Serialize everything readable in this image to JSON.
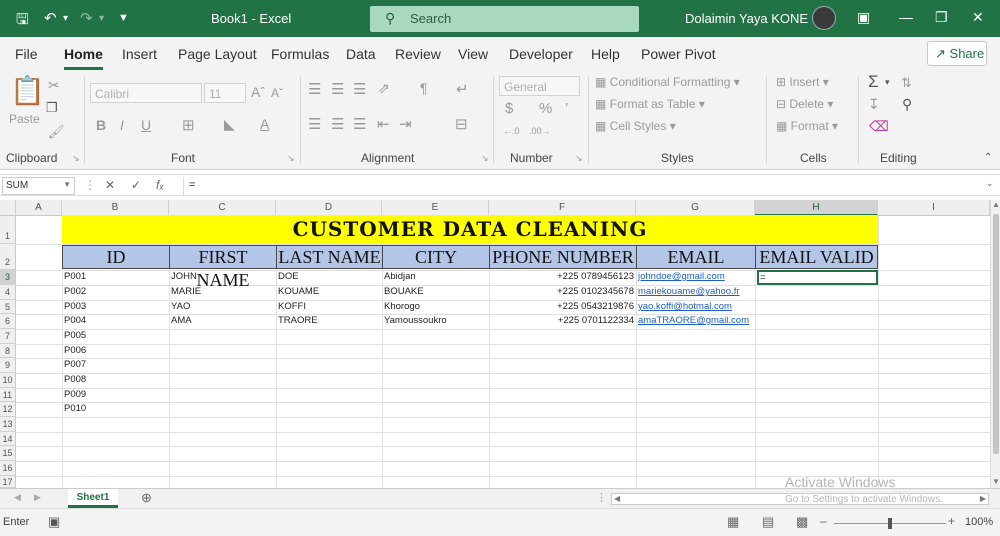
{
  "window": {
    "doc_title": "Book1 - Excel",
    "search_label": "Search",
    "user_name": "Dolaimin Yaya KONE"
  },
  "menu": [
    "File",
    "Home",
    "Insert",
    "Page Layout",
    "Formulas",
    "Data",
    "Review",
    "View",
    "Developer",
    "Help",
    "Power Pivot"
  ],
  "share_label": "Share",
  "ribbon": {
    "paste": "Paste",
    "font_name": "Calibri",
    "font_size": "11",
    "number_format": "General",
    "conditional_formatting": "Conditional Formatting",
    "format_as_table": "Format as Table",
    "cell_styles": "Cell Styles",
    "insert": "Insert",
    "delete": "Delete",
    "format": "Format",
    "groups": [
      "Clipboard",
      "Font",
      "Alignment",
      "Number",
      "Styles",
      "Cells",
      "Editing"
    ]
  },
  "formula_bar": {
    "name_box": "SUM",
    "content": "="
  },
  "columns": [
    "A",
    "B",
    "C",
    "D",
    "E",
    "F",
    "G",
    "H",
    "I"
  ],
  "rows": [
    "1",
    "2",
    "3",
    "4",
    "5",
    "6",
    "7",
    "8",
    "9",
    "10",
    "11",
    "12",
    "13",
    "14",
    "15",
    "16",
    "17"
  ],
  "sheet": {
    "title": "CUSTOMER DATA CLEANING",
    "headers": [
      "ID",
      "FIRST NAME",
      "LAST NAME",
      "CITY",
      "PHONE NUMBER",
      "EMAIL",
      "EMAIL VALID"
    ],
    "rows": [
      {
        "id": "P001",
        "first": "JOHN",
        "last": "DOE",
        "city": "Abidjan",
        "phone": "+225 0789456123",
        "email": "johndoe@gmail.com",
        "valid": "="
      },
      {
        "id": "P002",
        "first": "MARIE",
        "last": "KOUAME",
        "city": "BOUAKE",
        "phone": "+225 0102345678",
        "email": "mariekouame@yahoo.fr",
        "valid": ""
      },
      {
        "id": "P003",
        "first": "YAO",
        "last": "KOFFI",
        "city": "Khorogo",
        "phone": "+225 0543219876",
        "email": "yao.koffi@hotmal.com",
        "valid": ""
      },
      {
        "id": "P004",
        "first": "AMA",
        "last": "TRAORE",
        "city": "Yamoussoukro",
        "phone": "+225 0701122334",
        "email": "amaTRAORE@gmail.com",
        "valid": ""
      },
      {
        "id": "P005"
      },
      {
        "id": "P006"
      },
      {
        "id": "P007"
      },
      {
        "id": "P008"
      },
      {
        "id": "P009"
      },
      {
        "id": "P010"
      }
    ]
  },
  "sheet_tab": "Sheet1",
  "status": {
    "mode": "Enter",
    "zoom": "100%"
  },
  "watermark": {
    "line1": "Activate Windows",
    "line2": "Go to Settings to activate Windows."
  }
}
